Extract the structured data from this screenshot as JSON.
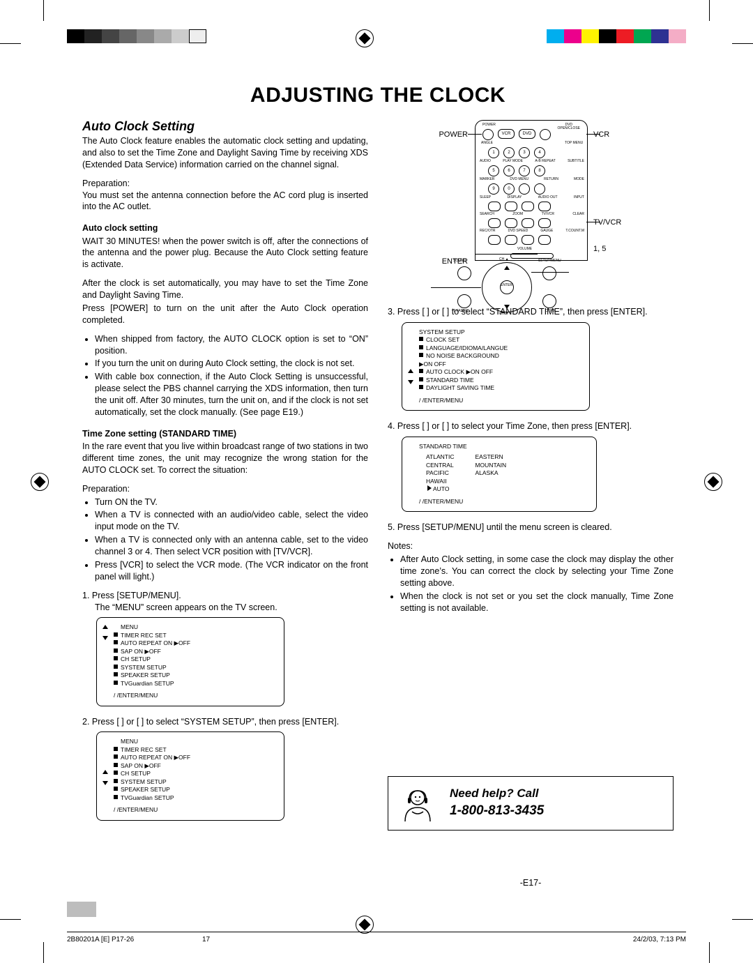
{
  "page_title": "ADJUSTING THE CLOCK",
  "section_title": "Auto Clock Setting",
  "intro": "The Auto Clock feature enables the automatic clock setting and updating, and also to set the Time Zone and Daylight Saving Time by receiving XDS (Extended Data Service) information carried on the channel signal.",
  "prep_label": "Preparation:",
  "prep_text": "You must set the antenna connection before the AC cord plug is inserted into the AC outlet.",
  "acs_heading": "Auto clock setting",
  "acs_p1": "WAIT 30 MINUTES! when the power switch is off, after the connections of the antenna and the power plug. Because the Auto Clock setting feature is activate.",
  "acs_p2": "After the clock is set automatically, you may have to set the Time Zone and Daylight Saving Time.",
  "acs_p3": "Press [POWER] to turn on the unit after the Auto Clock operation completed.",
  "acs_bullets": [
    "When shipped from factory, the AUTO CLOCK option is set to “ON” position.",
    "If you turn the unit on during Auto Clock setting, the clock is not set.",
    "With cable box connection, if the Auto Clock Setting is unsuccessful, please select the PBS channel carrying the XDS information, then turn the unit off. After 30 minutes, turn the unit on, and if the clock is not set automatically, set the clock manually. (See page E19.)"
  ],
  "tz_heading": "Time Zone setting (STANDARD TIME)",
  "tz_p1": "In the rare event that you live within broadcast range of two stations in two different time zones, the unit may recognize the wrong station for the AUTO CLOCK set. To correct the situation:",
  "tz_prep_label": "Preparation:",
  "tz_bullets": [
    "Turn ON the TV.",
    "When a TV is connected with an audio/video cable, select the video input mode on the TV.",
    "When a TV is connected only with an antenna cable, set to the video channel 3 or 4. Then select VCR position with [TV/VCR].",
    "Press [VCR] to select the VCR mode. (The VCR indicator on the front panel will light.)"
  ],
  "steps_left": [
    {
      "n": "1.",
      "t": "Press [SETUP/MENU].",
      "sub": "The “MENU” screen appears on the TV screen."
    },
    {
      "n": "2.",
      "t": "Press [  ] or [  ] to select “SYSTEM SETUP”, then press [ENTER]."
    }
  ],
  "osd_menu1": {
    "title": "MENU",
    "items": [
      "TIMER REC SET",
      "AUTO REPEAT   ON ▶OFF",
      "SAP                     ON ▶OFF",
      "CH SETUP",
      "SYSTEM SETUP",
      "SPEAKER SETUP",
      "TVGuardian SETUP"
    ],
    "footer": "/  /ENTER/MENU",
    "cursor_row": 1
  },
  "osd_menu2": {
    "title": "MENU",
    "items": [
      "TIMER REC SET",
      "AUTO REPEAT   ON ▶OFF",
      "SAP                     ON ▶OFF",
      "CH SETUP",
      "SYSTEM SETUP",
      "SPEAKER SETUP",
      "TVGuardian SETUP"
    ],
    "footer": "/  /ENTER/MENU",
    "cursor_row": 4
  },
  "remote_labels": {
    "power": "POWER",
    "vcr": "VCR",
    "tvvcr": "TV/VCR",
    "enter": "ENTER",
    "steps": "1, 5"
  },
  "steps_right": [
    {
      "n": "3.",
      "t": "Press [  ] or [  ] to select “STANDARD TIME”, then press [ENTER]."
    },
    {
      "n": "4.",
      "t": "Press [  ] or [  ] to select your Time Zone, then press [ENTER]."
    },
    {
      "n": "5.",
      "t": "Press [SETUP/MENU] until the menu screen is cleared."
    }
  ],
  "osd_sys": {
    "title": "SYSTEM SETUP",
    "items": [
      "CLOCK SET",
      "LANGUAGE/IDIOMA/LANGUE",
      "NO NOISE BACKGROUND",
      "           ▶ON   OFF",
      "AUTO CLOCK  ▶ON   OFF",
      "STANDARD TIME",
      "DAYLIGHT SAVING TIME"
    ],
    "footer": "/  /ENTER/MENU",
    "cursor_row": 5
  },
  "osd_std": {
    "title": "STANDARD TIME",
    "left": [
      "ATLANTIC",
      "CENTRAL",
      "PACIFIC",
      "HAWAII",
      "AUTO"
    ],
    "right": [
      "EASTERN",
      "MOUNTAIN",
      "ALASKA"
    ],
    "footer": "/  /ENTER/MENU",
    "cursor": "AUTO"
  },
  "notes_label": "Notes:",
  "notes": [
    "After Auto Clock setting, in some case the clock may display the other time zone’s. You can correct the clock by selecting your Time Zone setting above.",
    "When the clock is not set or you set the clock manually, Time Zone setting is not available."
  ],
  "help": {
    "title": "Need help? Call",
    "phone": "1-800-813-3435"
  },
  "page_number": "-E17-",
  "print_footer_left": "2B80201A [E] P17-26",
  "print_footer_center": "17",
  "print_footer_right": "24/2/03, 7:13 PM"
}
